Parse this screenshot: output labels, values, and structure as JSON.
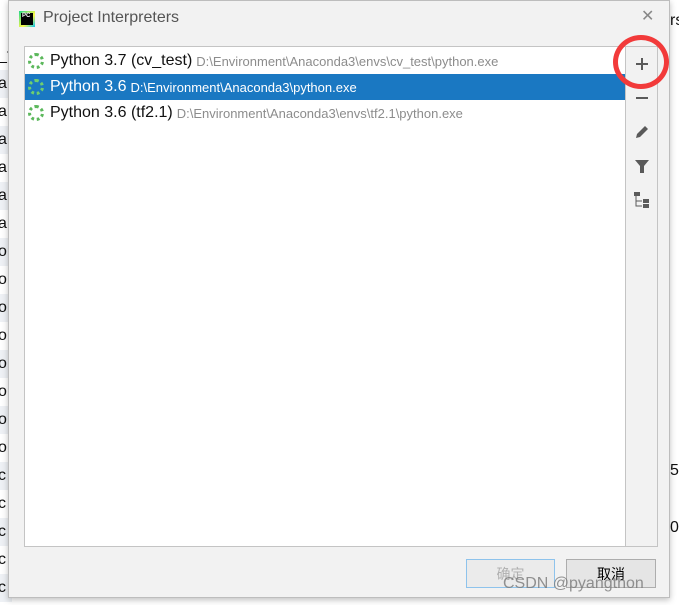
{
  "background": {
    "left_fragments": [
      "_t",
      "a",
      "a",
      "a",
      "a",
      "a:",
      "a",
      "o",
      "o",
      "o",
      "o",
      "o",
      "o",
      "o",
      "o",
      "c",
      "c",
      "c",
      "c",
      "c"
    ],
    "right_fragments": [
      "rs",
      "5",
      "0"
    ]
  },
  "dialog": {
    "title": "Project Interpreters",
    "logo_text": "PC",
    "close_icon": "close-icon",
    "interpreters": [
      {
        "name": "Python 3.7 (cv_test)",
        "path": "D:\\Environment\\Anaconda3\\envs\\cv_test\\python.exe",
        "selected": false
      },
      {
        "name": "Python 3.6",
        "path": "D:\\Environment\\Anaconda3\\python.exe",
        "selected": true
      },
      {
        "name": "Python 3.6 (tf2.1)",
        "path": "D:\\Environment\\Anaconda3\\envs\\tf2.1\\python.exe",
        "selected": false
      }
    ],
    "toolbar": [
      "plus-icon",
      "minus-icon",
      "pencil-icon",
      "filter-icon",
      "tree-icon"
    ],
    "ok_label": "确定",
    "cancel_label": "取消"
  },
  "annotation": {
    "color": "#f23a3a"
  },
  "watermark": "CSDN @pyangthon",
  "colors": {
    "selection": "#1a78c2"
  }
}
